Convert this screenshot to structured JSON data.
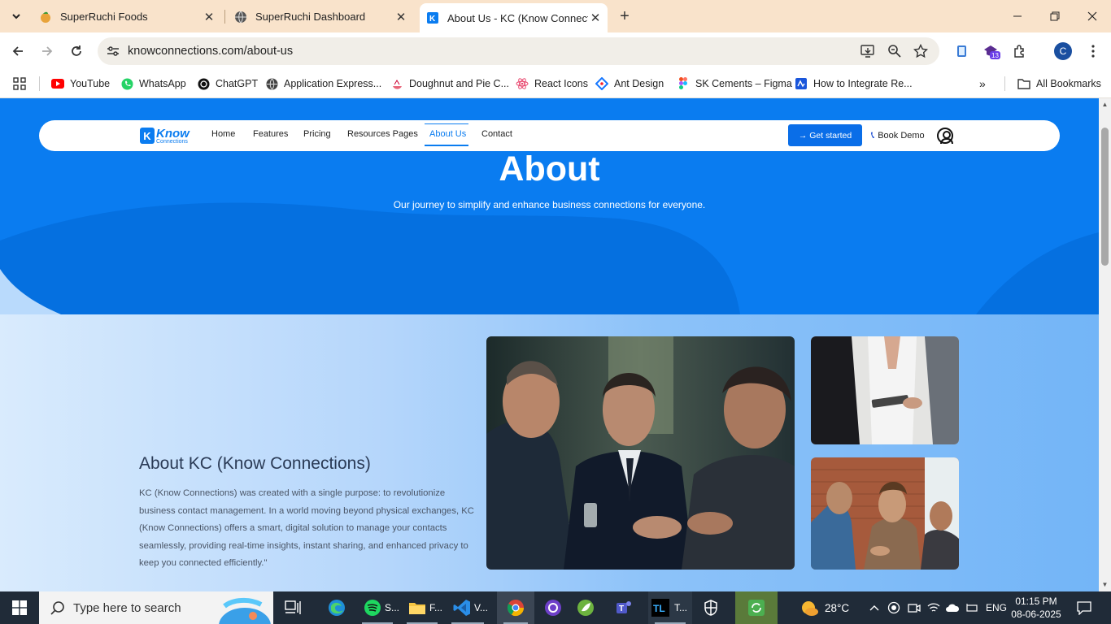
{
  "browser": {
    "tabs": [
      {
        "title": "SuperRuchi Foods",
        "icon": "superruchi-favicon",
        "active": false
      },
      {
        "title": "SuperRuchi Dashboard",
        "icon": "globe-icon",
        "active": false
      },
      {
        "title": "About Us - KC (Know Connections)",
        "title_visible": "About Us - KC (Know Connectio",
        "icon": "kc-favicon",
        "active": true
      }
    ],
    "new_tab": "+",
    "url": "knowconnections.com/about-us",
    "extension_badge": "13",
    "profile_initial": "C",
    "bookmarks": [
      {
        "label": "YouTube",
        "icon": "youtube-icon"
      },
      {
        "label": "WhatsApp",
        "icon": "whatsapp-icon"
      },
      {
        "label": "ChatGPT",
        "icon": "chatgpt-icon"
      },
      {
        "label": "Application Express...",
        "icon": "apex-icon"
      },
      {
        "label": "Doughnut and Pie C...",
        "icon": "chart-icon"
      },
      {
        "label": "React Icons",
        "icon": "react-icon"
      },
      {
        "label": "Ant Design",
        "icon": "antdesign-icon"
      },
      {
        "label": "SK Cements – Figma",
        "icon": "figma-icon"
      },
      {
        "label": "How to Integrate Re...",
        "icon": "article-icon"
      }
    ],
    "all_bookmarks": "All Bookmarks"
  },
  "site": {
    "logo": {
      "word1": "Know",
      "word2": "Connections"
    },
    "nav": [
      "Home",
      "Features",
      "Pricing",
      "Resources Pages",
      "About Us",
      "Contact"
    ],
    "active_nav": "About Us",
    "get_started": "→ Get started",
    "book_demo": "Book Demo",
    "hero_title": "About",
    "hero_subtitle": "Our journey to simplify and enhance business connections for everyone.",
    "section_title": "About KC (Know Connections)",
    "section_body": "KC (Know Connections) was created with a single purpose: to revolutionize business contact management. In a world moving beyond physical exchanges, KC (Know Connections) offers a smart, digital solution to manage your contacts seamlessly, providing real-time insights, instant sharing, and enhanced privacy to keep you connected efficiently.\"",
    "accent_color": "#0a7cf0"
  },
  "taskbar": {
    "search_placeholder": "Type here to search",
    "apps": [
      {
        "name": "task-view",
        "label": ""
      },
      {
        "name": "edge",
        "label": ""
      },
      {
        "name": "spotify",
        "label": "S..."
      },
      {
        "name": "file-explorer",
        "label": "F..."
      },
      {
        "name": "vscode",
        "label": "V..."
      },
      {
        "name": "chrome",
        "label": ""
      },
      {
        "name": "github-desktop",
        "label": ""
      },
      {
        "name": "spring-tool",
        "label": ""
      },
      {
        "name": "teams",
        "label": ""
      },
      {
        "name": "terminal",
        "label": "T..."
      },
      {
        "name": "security",
        "label": ""
      },
      {
        "name": "sync-app",
        "label": ""
      }
    ],
    "weather": "28°C",
    "language": "ENG",
    "time": "01:15 PM",
    "date": "08-06-2025"
  }
}
